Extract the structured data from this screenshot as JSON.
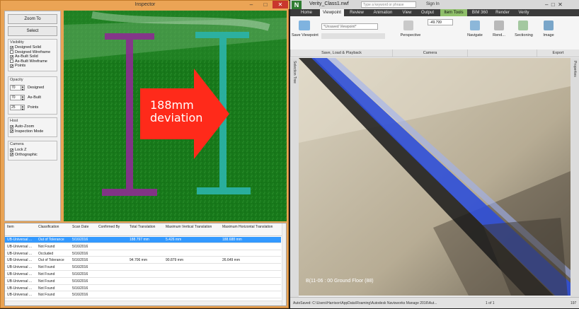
{
  "inspector": {
    "title": "Inspector",
    "minimize": "–",
    "maximize": "□",
    "close": "✕",
    "zoom_to": "Zoom To",
    "select": "Select",
    "visibility": {
      "label": "Visibility",
      "items": [
        {
          "label": "Designed Solid",
          "checked": true
        },
        {
          "label": "Designed Wireframe",
          "checked": false
        },
        {
          "label": "As-Built Solid",
          "checked": true
        },
        {
          "label": "As-Built Wireframe",
          "checked": false
        },
        {
          "label": "Points",
          "checked": true
        }
      ]
    },
    "opacity": {
      "label": "Opacity",
      "rows": [
        {
          "value": "70",
          "label": "Designed"
        },
        {
          "value": "70",
          "label": "As-Built"
        },
        {
          "value": "25",
          "label": "Points"
        }
      ]
    },
    "host": {
      "label": "Host",
      "items": [
        {
          "label": "Auto-Zoom",
          "checked": true
        },
        {
          "label": "Inspection Mode",
          "checked": true
        }
      ]
    },
    "camera": {
      "label": "Camera",
      "items": [
        {
          "label": "Lock Z",
          "checked": true
        },
        {
          "label": "Orthographic",
          "checked": true
        }
      ]
    },
    "annotation": {
      "line1": "188mm",
      "line2": "deviation",
      "arrow_color": "#ff2a1a",
      "text_color": "#ffffff"
    },
    "colors": {
      "designed_beam": "#8a2f8f",
      "asbuilt_beam": "#2bb3a8",
      "background": "#17781a"
    },
    "table": {
      "headers": [
        "Item",
        "Classification",
        "Scan Date",
        "Confirmed By",
        "Total Translation",
        "Maximum Vertical Translation",
        "Maximum Horizontal Translation"
      ],
      "rows": [
        [
          "UB-Universal ...",
          "Out of Tolerance",
          "5/16/2016",
          "",
          "188.797 mm",
          "5.426 mm",
          "188.688 mm"
        ],
        [
          "UB-Universal ...",
          "Not Found",
          "5/16/2016",
          "",
          "",
          "",
          ""
        ],
        [
          "UB-Universal ...",
          "Occluded",
          "5/16/2016",
          "",
          "",
          "",
          ""
        ],
        [
          "UB-Universal ...",
          "Out of Tolerance",
          "5/16/2016",
          "",
          "94.706 mm",
          "90.879 mm",
          "26.649 mm"
        ],
        [
          "UB-Universal ...",
          "Not Found",
          "5/16/2016",
          "",
          "",
          "",
          ""
        ],
        [
          "UB-Universal ...",
          "Not Found",
          "5/16/2016",
          "",
          "",
          "",
          ""
        ],
        [
          "UB-Universal ...",
          "Not Found",
          "5/16/2016",
          "",
          "",
          "",
          ""
        ],
        [
          "UB-Universal ...",
          "Not Found",
          "5/16/2016",
          "",
          "",
          "",
          ""
        ],
        [
          "UB-Universal ...",
          "Not Found",
          "5/16/2016",
          "",
          "",
          "",
          ""
        ]
      ],
      "selected_row": 0
    }
  },
  "navisworks": {
    "title": "Verity_Class1.nwf",
    "search_placeholder": "Type a keyword or phrase",
    "sign_in": "Sign In",
    "tabs": [
      "Home",
      "Viewpoint",
      "Review",
      "Animation",
      "View",
      "Output",
      "Item Tools",
      "BIM 360",
      "Render",
      "Verity"
    ],
    "active_tab": "Viewpoint",
    "ribbon": {
      "save_viewpoint": "Save Viewpoint",
      "viewpoint_dropdown": "*Unsaved Viewpoint*",
      "perspective": "Perspective",
      "field_value": "-49.799",
      "navigate": "Navigate",
      "render": "Rend...",
      "sectioning": "Sectioning",
      "image": "Image",
      "groups": [
        "Save, Load & Playback",
        "Camera",
        "Export"
      ]
    },
    "left_sidebar": "Selection Tree",
    "right_sidebar": "Properties",
    "scene_label": "B(11-06 : 00 Ground Floor (88)",
    "status": {
      "autosaved": "AutoSaved: C:\\Users\\Harrison\\AppData\\Roaming\\Autodesk Navisworks Manage 2016\\Aut...",
      "page": "1 of 1",
      "memory": "197"
    }
  }
}
